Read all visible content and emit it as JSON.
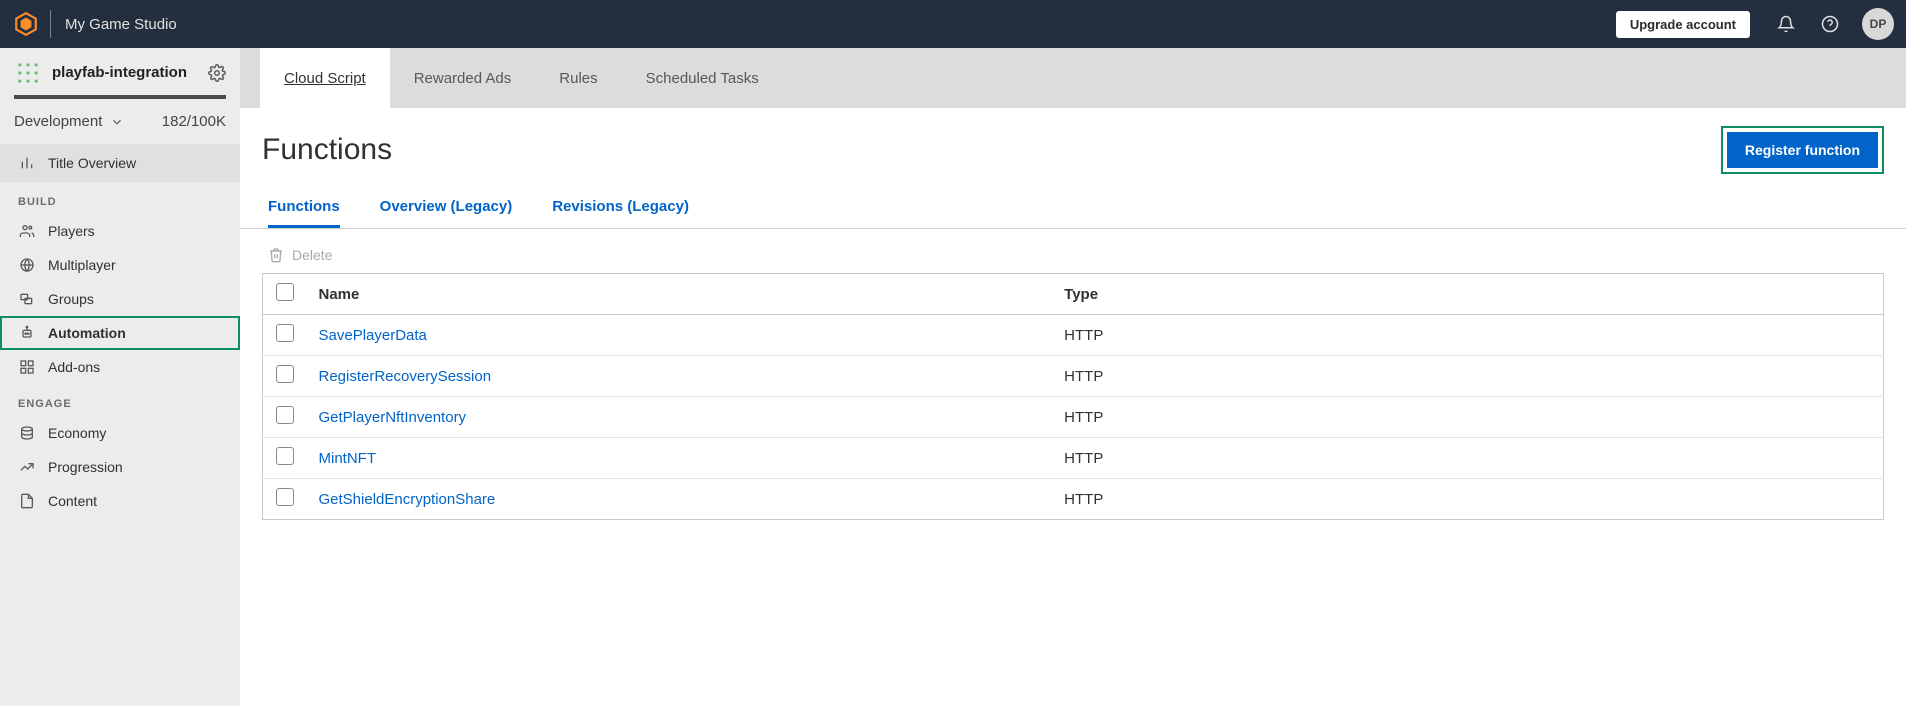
{
  "topbar": {
    "studio_name": "My Game Studio",
    "upgrade_label": "Upgrade account",
    "avatar_initials": "DP"
  },
  "sidebar": {
    "project_name": "playfab-integration",
    "environment": "Development",
    "usage": "182/100K",
    "title_overview": "Title Overview",
    "section_build": "BUILD",
    "section_engage": "ENGAGE",
    "build_items": [
      {
        "label": "Players"
      },
      {
        "label": "Multiplayer"
      },
      {
        "label": "Groups"
      },
      {
        "label": "Automation"
      },
      {
        "label": "Add-ons"
      }
    ],
    "engage_items": [
      {
        "label": "Economy"
      },
      {
        "label": "Progression"
      },
      {
        "label": "Content"
      }
    ]
  },
  "main_tabs": [
    "Cloud Script",
    "Rewarded Ads",
    "Rules",
    "Scheduled Tasks"
  ],
  "page": {
    "title": "Functions",
    "register_button": "Register function",
    "sub_tabs": [
      "Functions",
      "Overview (Legacy)",
      "Revisions (Legacy)"
    ],
    "delete_label": "Delete",
    "columns": {
      "name": "Name",
      "type": "Type"
    },
    "functions": [
      {
        "name": "SavePlayerData",
        "type": "HTTP"
      },
      {
        "name": "RegisterRecoverySession",
        "type": "HTTP"
      },
      {
        "name": "GetPlayerNftInventory",
        "type": "HTTP"
      },
      {
        "name": "MintNFT",
        "type": "HTTP"
      },
      {
        "name": "GetShieldEncryptionShare",
        "type": "HTTP"
      }
    ]
  }
}
